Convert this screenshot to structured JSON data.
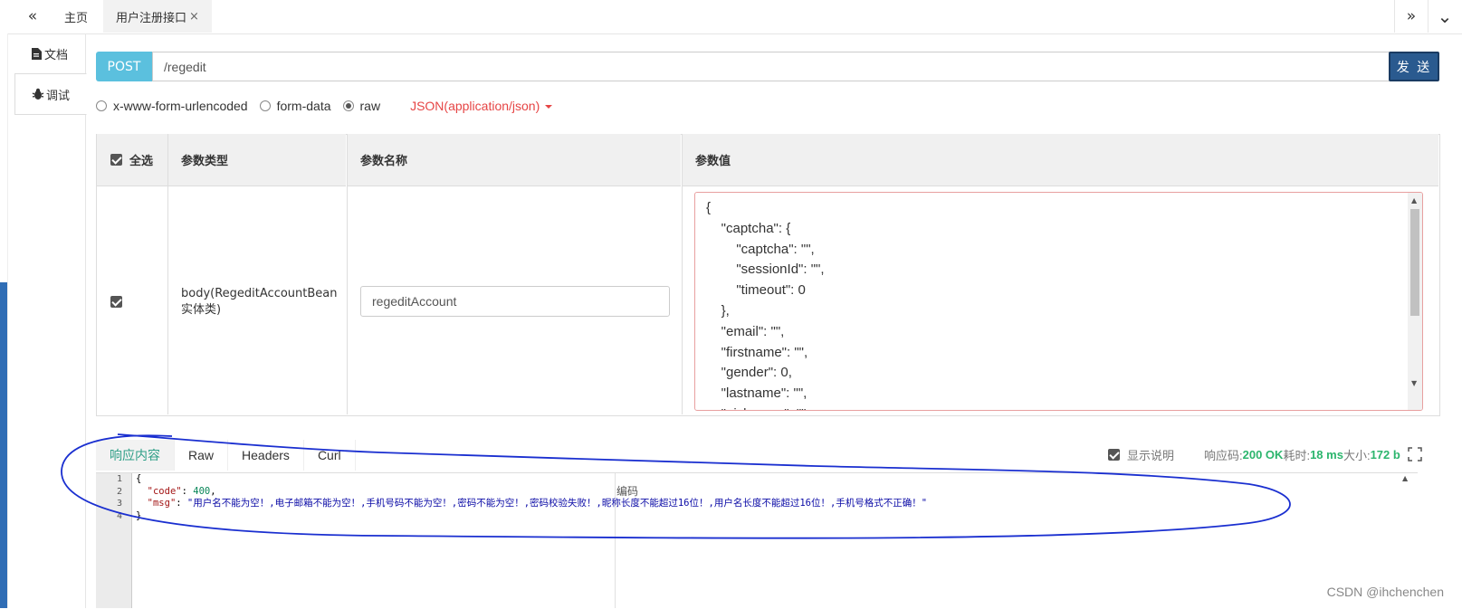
{
  "tabs_bar": {
    "left_nav": "«",
    "right_nav": "»",
    "collapse": "⌄",
    "tabs": [
      {
        "label": "主页",
        "active": false
      },
      {
        "label": "用户注册接口",
        "active": true,
        "close": "×"
      }
    ]
  },
  "side_tabs": [
    {
      "label": "文档",
      "icon": "document-icon"
    },
    {
      "label": "调试",
      "icon": "bug-icon",
      "active": true
    }
  ],
  "request": {
    "method": "POST",
    "url": "/regedit",
    "send_label": "发 送"
  },
  "body_type": {
    "options": [
      "x-www-form-urlencoded",
      "form-data",
      "raw"
    ],
    "selected": "raw",
    "content_type": "JSON(application/json)"
  },
  "params_table": {
    "headers": {
      "select_all": "全选",
      "type": "参数类型",
      "name": "参数名称",
      "value": "参数值"
    },
    "row": {
      "checked": true,
      "type": "body(RegeditAccountBean实体类)",
      "name": "regeditAccount",
      "value": "{\n\t\"captcha\": {\n\t\t\"captcha\": \"\",\n\t\t\"sessionId\": \"\",\n\t\t\"timeout\": 0\n\t},\n\t\"email\": \"\",\n\t\"firstname\": \"\",\n\t\"gender\": 0,\n\t\"lastname\": \"\",\n\t\"nickname\": \"\","
    }
  },
  "response": {
    "tabs": [
      "响应内容",
      "Raw",
      "Headers",
      "Curl"
    ],
    "active_tab": "响应内容",
    "show_desc_label": "显示说明",
    "status_label": "响应码:",
    "status_value": "200 OK",
    "time_label": "耗时:",
    "time_value": "18 ms",
    "size_label": "大小:",
    "size_value": "172 b",
    "code_hint": "编码",
    "line_numbers": [
      "1",
      "2",
      "3",
      "4"
    ],
    "body": {
      "open": "{",
      "code_key": "\"code\"",
      "code_value": "400",
      "msg_key": "\"msg\"",
      "msg_value": "\"用户名不能为空！,电子邮箱不能为空！,手机号码不能为空！,密码不能为空！,密码校验失败！,昵称长度不能超过16位！,用户名长度不能超过16位！,手机号格式不正确！\"",
      "close": "}"
    }
  },
  "watermark": "CSDN @ihchenchen",
  "colors": {
    "method_bg": "#5bc0de",
    "send_bg": "#2a5a8f",
    "active_response_tab": "#2e9f87",
    "status_ok": "#2cb56d",
    "content_type": "#e64545"
  }
}
